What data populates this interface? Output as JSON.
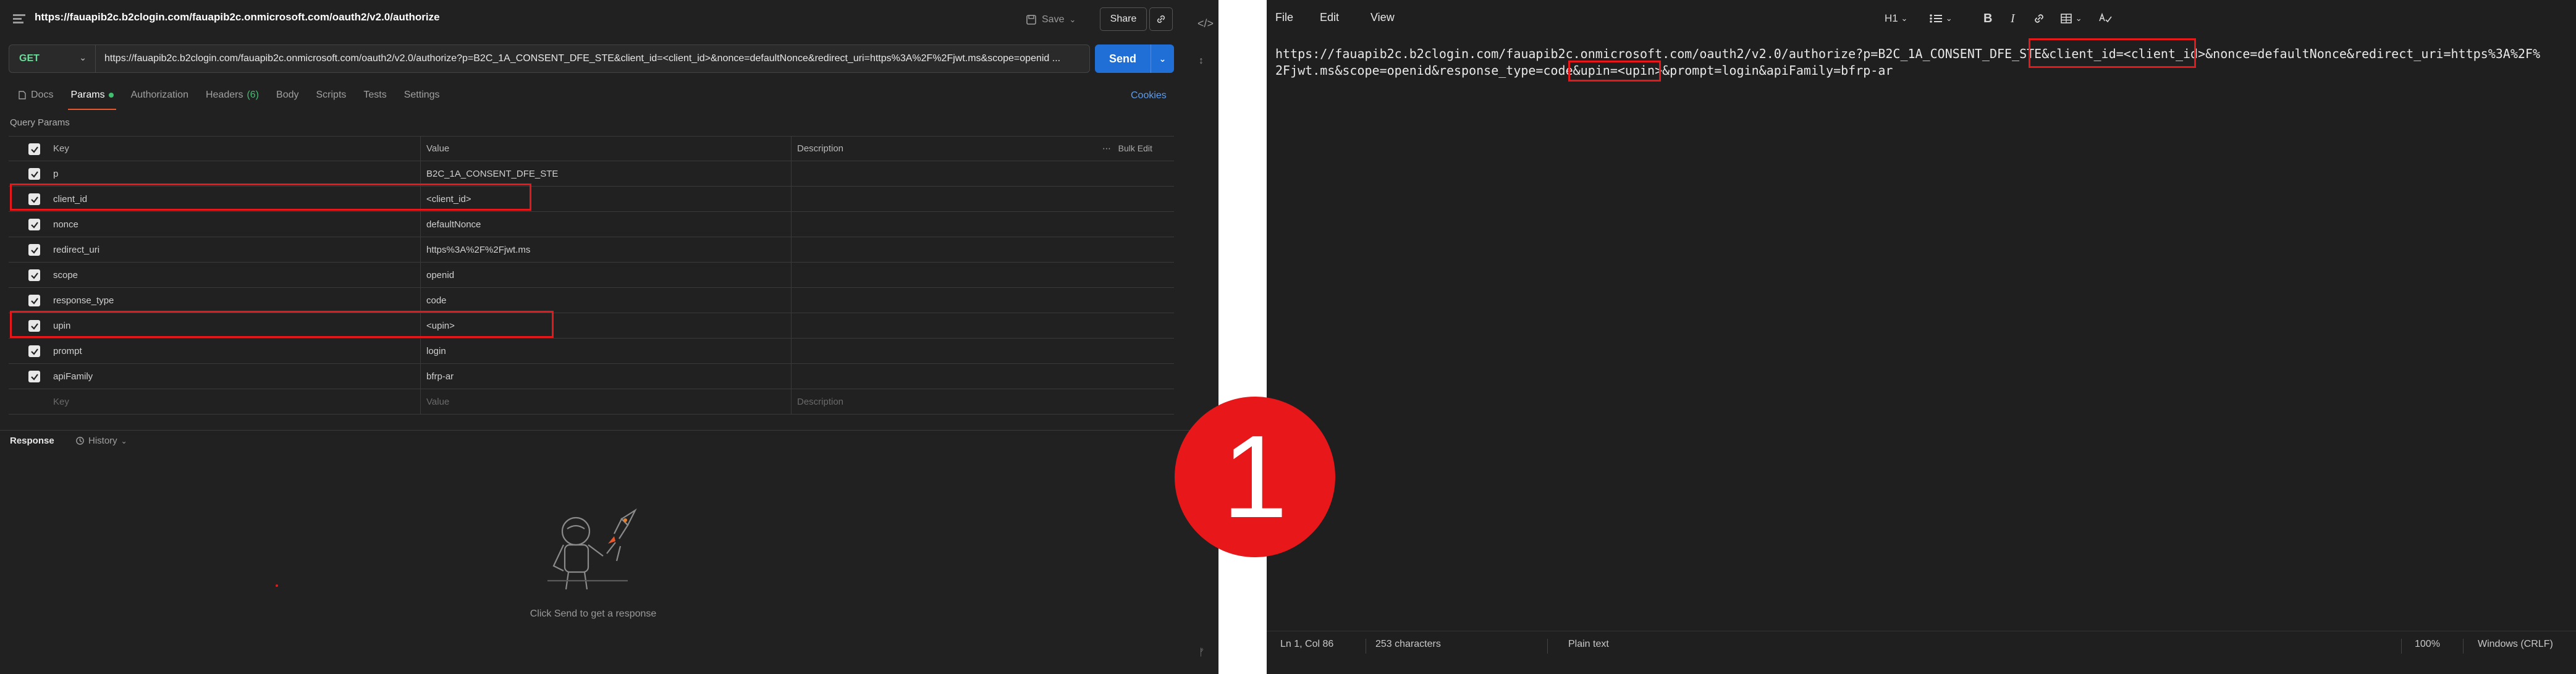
{
  "request": {
    "title": "https://fauapib2c.b2clogin.com/fauapib2c.onmicrosoft.com/oauth2/v2.0/authorize",
    "save_label": "Save",
    "share_label": "Share",
    "method": "GET",
    "url": "https://fauapib2c.b2clogin.com/fauapib2c.onmicrosoft.com/oauth2/v2.0/authorize?p=B2C_1A_CONSENT_DFE_STE&client_id=<client_id>&nonce=defaultNonce&redirect_uri=https%3A%2F%2Fjwt.ms&scope=openid ...",
    "send_label": "Send"
  },
  "tabs": [
    {
      "label": "Docs"
    },
    {
      "label": "Params"
    },
    {
      "label": "Authorization"
    },
    {
      "label": "Headers"
    },
    {
      "label": "Body"
    },
    {
      "label": "Scripts"
    },
    {
      "label": "Tests"
    },
    {
      "label": "Settings"
    }
  ],
  "headers_count": "(6)",
  "cookies_label": "Cookies",
  "query_params_label": "Query Params",
  "table": {
    "col_key": "Key",
    "col_value": "Value",
    "col_description": "Description",
    "bulk_edit": "Bulk Edit",
    "rows": [
      {
        "key": "p",
        "value": "B2C_1A_CONSENT_DFE_STE"
      },
      {
        "key": "client_id",
        "value": "<client_id>"
      },
      {
        "key": "nonce",
        "value": "defaultNonce"
      },
      {
        "key": "redirect_uri",
        "value": "https%3A%2F%2Fjwt.ms"
      },
      {
        "key": "scope",
        "value": "openid"
      },
      {
        "key": "response_type",
        "value": "code"
      },
      {
        "key": "upin",
        "value": "<upin>"
      },
      {
        "key": "prompt",
        "value": "login"
      },
      {
        "key": "apiFamily",
        "value": "bfrp-ar"
      }
    ],
    "placeholder_key": "Key",
    "placeholder_value": "Value",
    "placeholder_description": "Description"
  },
  "response": {
    "label": "Response",
    "history_label": "History",
    "empty_message": "Click Send to get a response"
  },
  "badge_number": "1",
  "notepad": {
    "menu": [
      "File",
      "Edit",
      "View"
    ],
    "heading_select": "H1",
    "line1_a": "https://fauapib2c.b2clogin.com/fauapib2c.onmicrosoft.com/oauth2/v2.0/authorize?p=B2C_1A_CONSENT_DFE_STE&",
    "line1_b": "client_id=<client_id>",
    "line1_c": "&nonce=defaultNonce&redirect_uri=https%3A%2F%",
    "line2_a": "2Fjwt.ms&scope=openid&response_type=code&",
    "line2_b": "upin=<upin>",
    "line2_c": "&prompt=login&apiFamily=bfrp-ar",
    "status_position": "Ln 1, Col 86",
    "status_chars": "253 characters",
    "status_format": "Plain text",
    "status_zoom": "100%",
    "status_eol": "Windows (CRLF)"
  },
  "colors": {
    "highlight": "#e8171a",
    "send": "#1f6fd6",
    "method": "#6bdd9a",
    "active_tab": "#e8582c"
  }
}
